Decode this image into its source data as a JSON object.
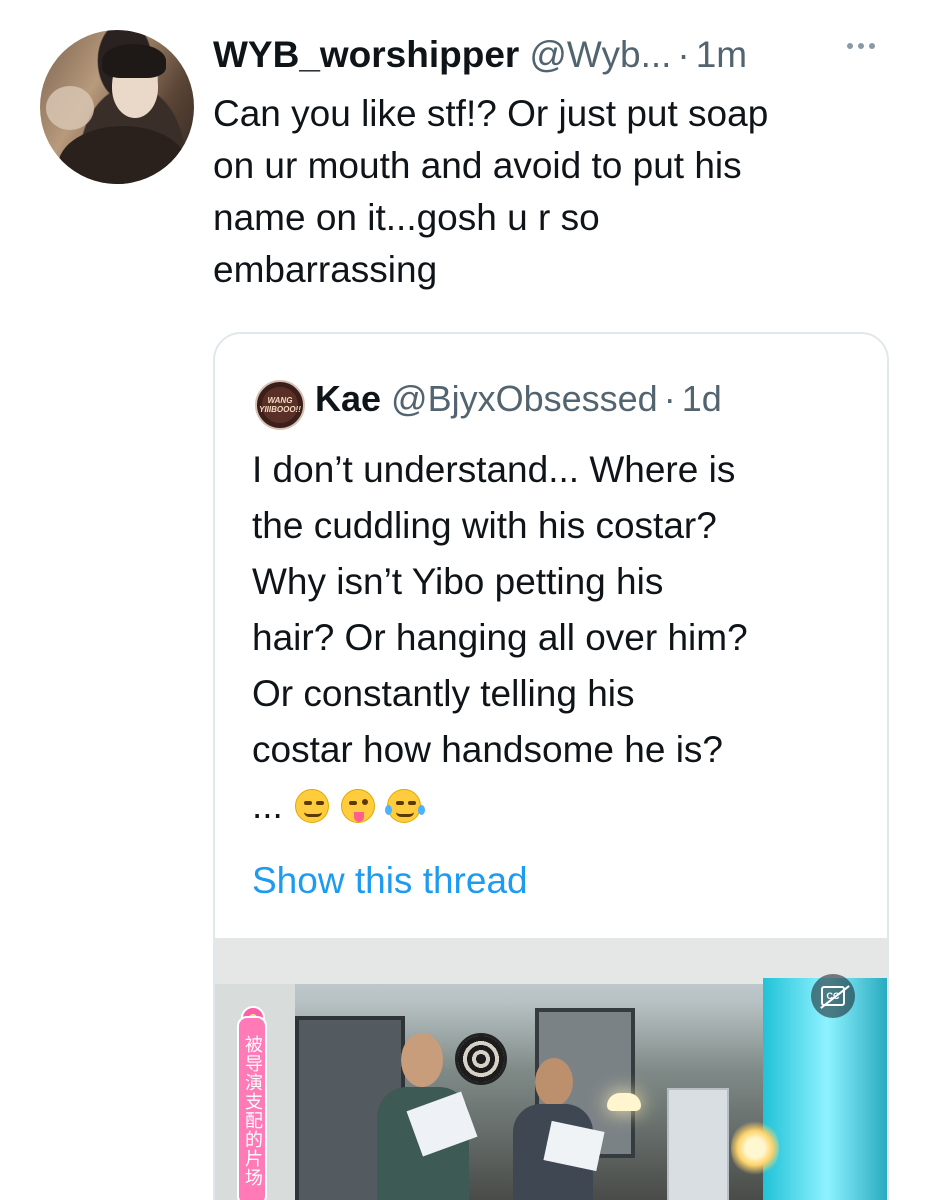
{
  "tweet": {
    "display_name": "WYB_worshipper",
    "handle": "@Wyb...",
    "separator": "·",
    "timestamp": "1m",
    "text_lines": [
      "Can you like stf!? Or just put soap",
      "on ur mouth and avoid to put his",
      "name on it...gosh u r so",
      "embarrassing"
    ]
  },
  "quote": {
    "avatar_lines": [
      "WANG",
      "YIIIBOOO!!"
    ],
    "display_name": "Kae",
    "handle": "@BjyxObsessed",
    "separator": "·",
    "timestamp": "1d",
    "text_lines": [
      "I don’t understand... Where is",
      "the cuddling with his costar?",
      "Why isn’t Yibo petting his",
      "hair? Or hanging all over him?",
      "Or constantly telling his",
      "costar how handsome he is?"
    ],
    "ellipsis": "...",
    "show_thread": "Show this thread",
    "media": {
      "caption": "被导演支配的片场"
    }
  },
  "icons": [
    "more-icon",
    "captions-off-icon"
  ],
  "colors": {
    "link": "#1d9bf0",
    "secondary_text": "#536471",
    "border": "#e1e8ed"
  }
}
